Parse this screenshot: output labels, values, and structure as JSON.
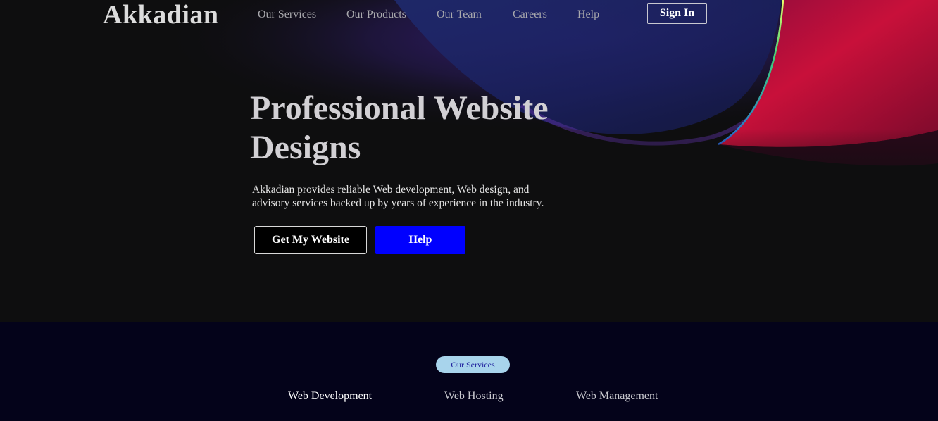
{
  "header": {
    "logo": "Akkadian",
    "nav": [
      "Our Services",
      "Our Products",
      "Our Team",
      "Careers",
      "Help"
    ],
    "sign_in": "Sign In"
  },
  "hero": {
    "title": "Professional Website Designs",
    "description": "Akkadian provides reliable Web development, Web design, and advisory services backed up by years of experience in the industry.",
    "primary_button": "Get My Website",
    "secondary_button": "Help"
  },
  "services": {
    "badge": "Our Services",
    "tabs": [
      "Web Development",
      "Web Hosting",
      "Web Management"
    ],
    "active_tab": "Web Development"
  },
  "colors": {
    "help_button": "#0000ff",
    "services_background": "#04031a",
    "badge_background": "#a8d4ec",
    "accent_ribbon": "#c8103a"
  }
}
